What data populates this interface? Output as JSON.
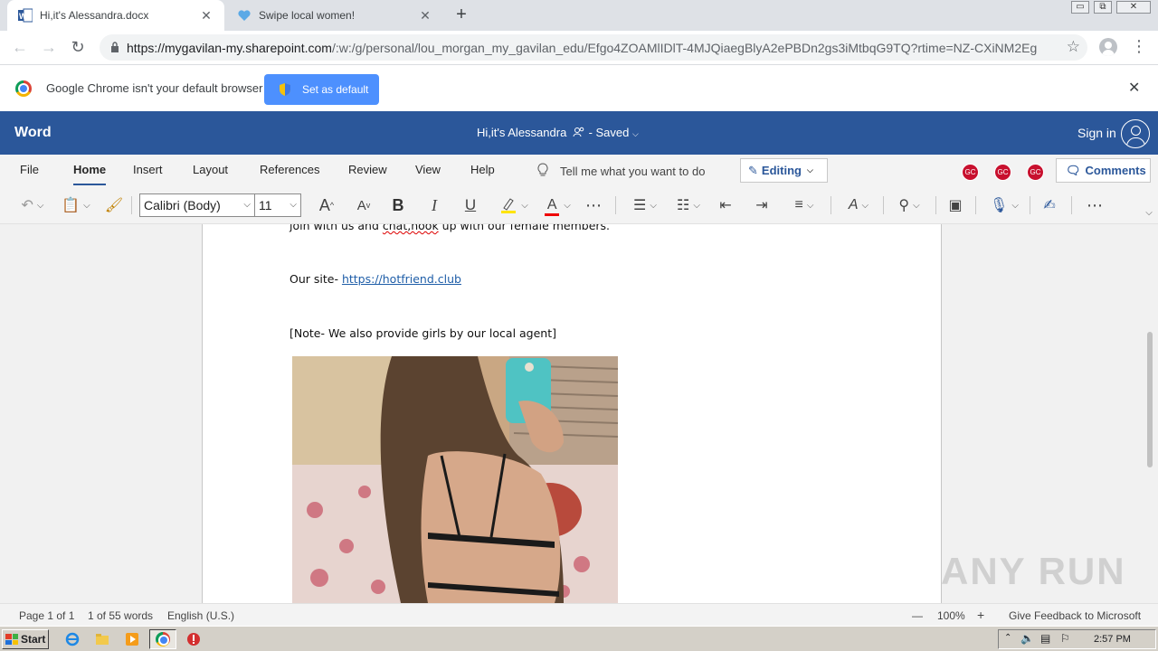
{
  "browser": {
    "tabs": [
      {
        "title": "Hi,it's Alessandra.docx",
        "close": "✕"
      },
      {
        "title": "Swipe local women!",
        "close": "✕"
      }
    ],
    "new_tab": "+",
    "window_controls": {
      "minimize": "▭",
      "restore": "⧉",
      "close": "✕"
    },
    "url_host": "https://mygavilan-my.sharepoint.com",
    "url_path": "/:w:/g/personal/lou_morgan_my_gavilan_edu/Efgo4ZOAMlIDlT-4MJQiaegBlyA2ePBDn2gs3iMtbqG9TQ?rtime=NZ-CXiNM2Eg",
    "infobar_text": "Google Chrome isn't your default browser",
    "set_default_label": "Set as default",
    "infobar_close": "✕"
  },
  "word": {
    "brand": "Word",
    "doc_title": "Hi,it's Alessandra",
    "doc_status": "Saved",
    "sign_in": "Sign in",
    "menu": [
      "File",
      "Home",
      "Insert",
      "Layout",
      "References",
      "Review",
      "View",
      "Help"
    ],
    "tell_me": "Tell me what you want to do",
    "editing_label": "Editing",
    "avatars": [
      "GC",
      "GC",
      "GC"
    ],
    "comments_label": "Comments",
    "font_name": "Calibri (Body)",
    "font_size": "11",
    "tools": {
      "grow": "A",
      "shrink": "A",
      "bold": "B",
      "italic": "I",
      "underline": "U",
      "font_color": "A",
      "more": "⋯",
      "overflow": "⋯"
    }
  },
  "document": {
    "line1_pre": "join with us and ",
    "line1_flag": "chat,hook",
    "line1_post": " up with our female members.",
    "site_label": "Our site- ",
    "site_link": "https://hotfriend.club",
    "note": "[Note- We also provide girls by our local agent]"
  },
  "status": {
    "page": "Page 1 of 1",
    "words": "1 of 55 words",
    "language": "English (U.S.)",
    "zoom_out": "—",
    "zoom": "100%",
    "zoom_in": "+",
    "feedback": "Give Feedback to Microsoft"
  },
  "watermark": "ANY RUN",
  "taskbar": {
    "start": "Start",
    "clock": "2:57 PM"
  },
  "colors": {
    "word_blue": "#2b579a",
    "chrome_button": "#4d90fe",
    "avatar_red": "#c8102e",
    "link_blue": "#1f5ea8"
  }
}
